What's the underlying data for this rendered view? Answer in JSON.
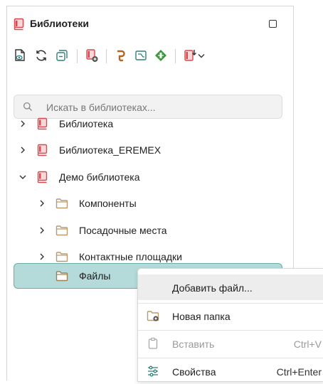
{
  "panel": {
    "title": "Библиотеки"
  },
  "toolbar": {
    "buttons": [
      {
        "icon": "library-view-icon"
      },
      {
        "icon": "refresh-icon"
      },
      {
        "icon": "collapse-all-icon"
      },
      {
        "icon": "add-library-icon"
      },
      {
        "icon": "link-icon"
      },
      {
        "icon": "symbol-icon"
      },
      {
        "icon": "component-icon"
      },
      {
        "icon": "import-icon"
      },
      {
        "icon": "chevron-down-icon"
      }
    ]
  },
  "search": {
    "placeholder": "Искать в библиотеках..."
  },
  "tree": {
    "libraries": [
      {
        "label": "Библиотека",
        "expanded": false
      },
      {
        "label": "Библиотека_EREMEX",
        "expanded": false
      },
      {
        "label": "Демо библиотека",
        "expanded": true
      }
    ],
    "folders": [
      {
        "label": "Компоненты",
        "expanded": false
      },
      {
        "label": "Посадочные места",
        "expanded": false
      },
      {
        "label": "Контактные площадки",
        "expanded": false
      },
      {
        "label": "Файлы",
        "selected": true
      }
    ]
  },
  "context_menu": {
    "items": [
      {
        "label": "Добавить файл...",
        "shortcut": "",
        "enabled": true,
        "icon": ""
      },
      {
        "label": "Новая папка",
        "shortcut": "",
        "enabled": true,
        "icon": "new-folder-icon"
      },
      {
        "label": "Вставить",
        "shortcut": "Ctrl+V",
        "enabled": false,
        "icon": "paste-icon"
      },
      {
        "label": "Свойства",
        "shortcut": "Ctrl+Enter",
        "enabled": true,
        "icon": "properties-icon"
      }
    ]
  },
  "colors": {
    "library_red": "#d9484e",
    "folder_brown": "#b99a6e",
    "selection_fill": "#b4dad9",
    "selection_border": "#6aaeaa",
    "link_orange": "#b5651d",
    "component_green": "#3a9a3a"
  }
}
